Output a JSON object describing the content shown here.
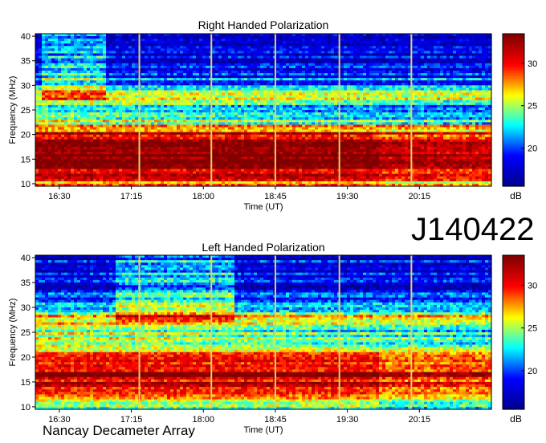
{
  "figure": {
    "observation_id": "J140422",
    "observatory": "Nancay Decameter Array"
  },
  "chart_data": [
    {
      "type": "heatmap",
      "title": "Right Handed Polarization",
      "xlabel": "Time (UT)",
      "ylabel": "Frequency (MHz)",
      "x_ticks": [
        "16:30",
        "17:15",
        "18:00",
        "18:45",
        "19:30",
        "20:15"
      ],
      "y_ticks": [
        "10",
        "15",
        "20",
        "25",
        "30",
        "35",
        "40"
      ],
      "xlim": [
        "16:15",
        "21:00"
      ],
      "ylim": [
        9.5,
        40.5
      ],
      "colorbar": {
        "label": "dB",
        "ticks": [
          "20",
          "25",
          "30"
        ],
        "range": [
          15.5,
          33.5
        ]
      },
      "grid": false,
      "colormap": [
        "#00008f",
        "#0000ff",
        "#00ffff",
        "#ffff00",
        "#ff0000",
        "#800000"
      ],
      "intensity_profile": {
        "freq_MHz": [
          10,
          12,
          14,
          16,
          18,
          20,
          22,
          24,
          26,
          28,
          30,
          32,
          34,
          36,
          38,
          40
        ],
        "dB": [
          27,
          31.5,
          32,
          32.5,
          32,
          31,
          27,
          25,
          24,
          27,
          21,
          20,
          18.5,
          18,
          18,
          17.5
        ]
      },
      "sweep_times": [
        "17:20",
        "18:05",
        "18:45",
        "19:25",
        "20:10"
      ],
      "glow_window": [
        "16:20",
        "17:00"
      ]
    },
    {
      "type": "heatmap",
      "title": "Left Handed Polarization",
      "xlabel": "Time (UT)",
      "ylabel": "Frequency (MHz)",
      "x_ticks": [
        "16:30",
        "17:15",
        "18:00",
        "18:45",
        "19:30",
        "20:15"
      ],
      "y_ticks": [
        "10",
        "15",
        "20",
        "25",
        "30",
        "35",
        "40"
      ],
      "xlim": [
        "16:15",
        "21:00"
      ],
      "ylim": [
        9.5,
        40.5
      ],
      "colorbar": {
        "label": "dB",
        "ticks": [
          "20",
          "25",
          "30"
        ],
        "range": [
          15.5,
          33.5
        ]
      },
      "grid": false,
      "colormap": [
        "#00008f",
        "#0000ff",
        "#00ffff",
        "#ffff00",
        "#ff0000",
        "#800000"
      ],
      "intensity_profile": {
        "freq_MHz": [
          10,
          12,
          14,
          16,
          18,
          20,
          22,
          24,
          26,
          28,
          30,
          32,
          34,
          36,
          38,
          40
        ],
        "dB": [
          25,
          30,
          31.5,
          32,
          31.5,
          30,
          27,
          25,
          26,
          26.5,
          21,
          20,
          18.5,
          18,
          18,
          17.5
        ]
      },
      "sweep_times": [
        "17:20",
        "18:05",
        "18:45",
        "19:25",
        "20:10"
      ],
      "glow_window": [
        "17:05",
        "18:20"
      ]
    }
  ]
}
